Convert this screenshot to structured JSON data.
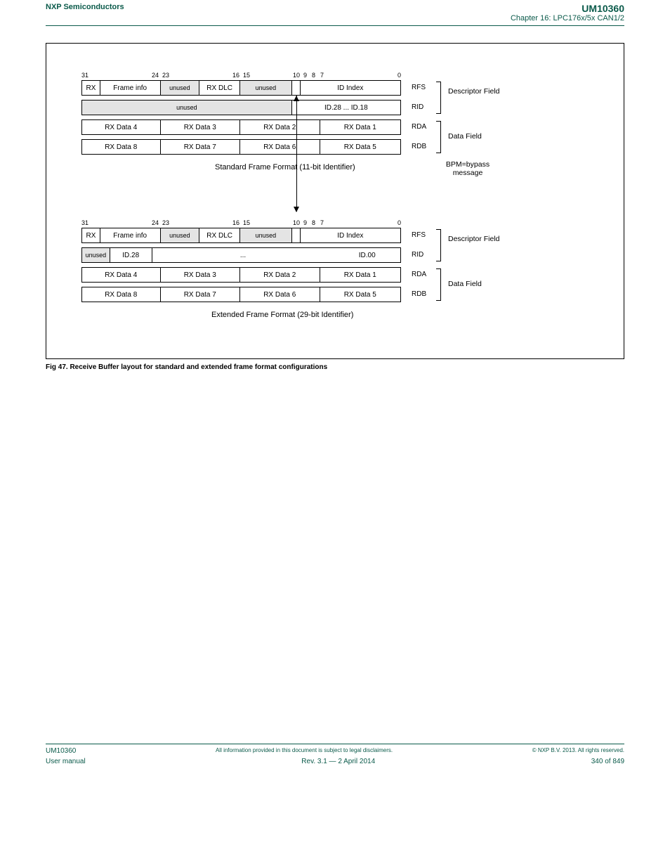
{
  "header": {
    "left": "NXP Semiconductors",
    "right_line1": "UM10360",
    "right_line2": "Chapter 16: LPC176x/5x CAN1/2"
  },
  "bits": {
    "b31": "31",
    "b24": "24",
    "b23": "23",
    "b16": "16",
    "b15": "15",
    "b10": "10",
    "b9": "9",
    "b8": "8",
    "b7": "7",
    "b0": "0"
  },
  "top": {
    "row1": {
      "rx": "RX",
      "frameinfo": "Frame info",
      "unused": "unused",
      "rxdlc": "RX DLC",
      "unused2": "unused",
      "idindex": "ID Index",
      "reg": "RFS"
    },
    "row2": {
      "unused": "unused",
      "id": "ID.28 ... ID.18",
      "reg": "RID"
    },
    "row3": {
      "d4": "RX Data 4",
      "d3": "RX Data 3",
      "d2": "RX Data 2",
      "d1": "RX Data 1",
      "reg": "RDA"
    },
    "row4": {
      "d8": "RX Data 8",
      "d7": "RX Data 7",
      "d6": "RX Data 6",
      "d5": "RX Data 5",
      "reg": "RDB"
    },
    "caption": "Standard Frame Format (11-bit Identifier)",
    "side1": "Descriptor Field",
    "side2": "Data Field",
    "bpm": "BPM=bypass message"
  },
  "bot": {
    "row1": {
      "rx": "RX",
      "frameinfo": "Frame info",
      "unused": "unused",
      "rxdlc": "RX DLC",
      "unused2": "unused",
      "idindex": "ID Index",
      "reg": "RFS"
    },
    "row2": {
      "unused": "unused",
      "id28": "ID.28",
      "dots": "...",
      "id00": "ID.00",
      "reg": "RID"
    },
    "row3": {
      "d4": "RX Data 4",
      "d3": "RX Data 3",
      "d2": "RX Data 2",
      "d1": "RX Data 1",
      "reg": "RDA"
    },
    "row4": {
      "d8": "RX Data 8",
      "d7": "RX Data 7",
      "d6": "RX Data 6",
      "d5": "RX Data 5",
      "reg": "RDB"
    },
    "caption": "Extended Frame Format (29-bit Identifier)",
    "side1": "Descriptor Field",
    "side2": "Data Field"
  },
  "figcaption": "Fig 47. Receive Buffer layout for standard and extended frame format configurations",
  "footer": {
    "left": "UM10360",
    "mid": "All information provided in this document is subject to legal disclaimers.",
    "right": "© NXP B.V. 2013. All rights reserved.",
    "bl": "User manual",
    "bm": "Rev. 3.1 — 2 April 2014",
    "br": "340 of 849"
  }
}
